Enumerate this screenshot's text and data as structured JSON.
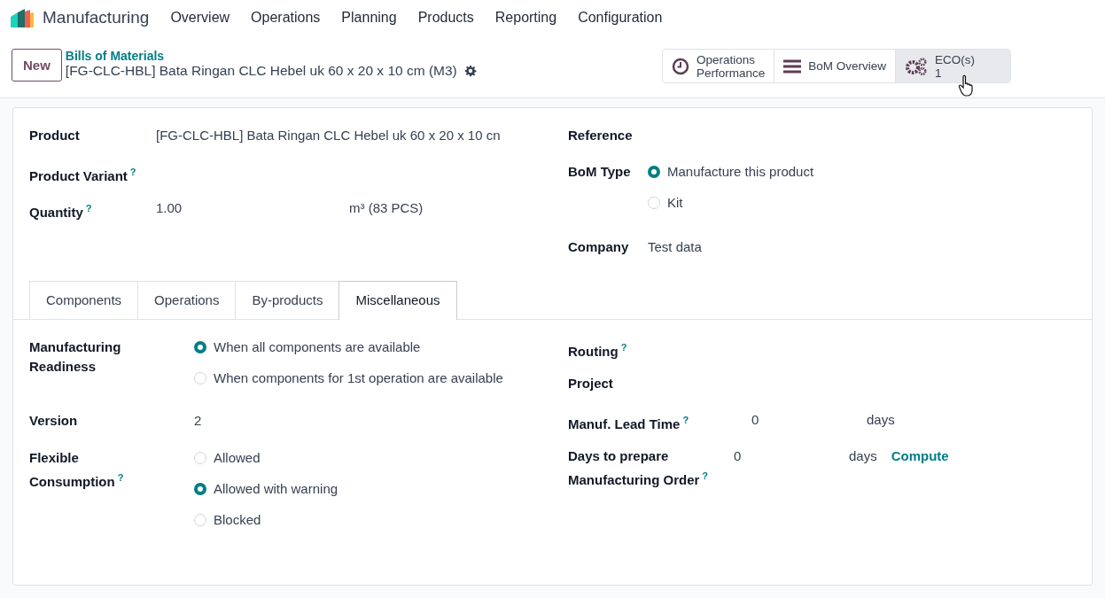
{
  "app": {
    "name": "Manufacturing",
    "menu": [
      "Overview",
      "Operations",
      "Planning",
      "Products",
      "Reporting",
      "Configuration"
    ]
  },
  "control_panel": {
    "new_button": "New",
    "breadcrumb_parent": "Bills of Materials",
    "record_title": "[FG-CLC-HBL] Bata Ringan CLC Hebel uk 60 x 20 x 10 cm (M3)"
  },
  "smart_buttons": [
    {
      "kind": "clock",
      "lines": [
        "Operations",
        "Performance"
      ],
      "hovered": false
    },
    {
      "kind": "list",
      "lines": [
        "BoM Overview"
      ],
      "hovered": false
    },
    {
      "kind": "gears",
      "lines": [
        "ECO(s)",
        "1"
      ],
      "hovered": true
    }
  ],
  "header_left": [
    {
      "kind": "text",
      "label": "Product",
      "value": "[FG-CLC-HBL] Bata Ringan CLC Hebel uk 60 x 20 x 10 cn"
    },
    {
      "kind": "text",
      "label": "Product Variant",
      "help": "?"
    },
    {
      "kind": "text",
      "label": "Quantity",
      "help": "?",
      "value": "1.00",
      "unit": "m³ (83 PCS)"
    }
  ],
  "header_right": [
    {
      "kind": "text",
      "label": "Reference"
    },
    {
      "kind": "radio",
      "label": "BoM Type",
      "options": [
        {
          "label": "Manufacture this product",
          "selected": true
        },
        {
          "label": "Kit",
          "selected": false
        }
      ]
    },
    {
      "kind": "text",
      "label": "Company",
      "value": "Test data"
    }
  ],
  "tabs": [
    {
      "label": "Components",
      "selected": false
    },
    {
      "label": "Operations",
      "selected": false
    },
    {
      "label": "By-products",
      "selected": false
    },
    {
      "label": "Miscellaneous",
      "selected": true
    }
  ],
  "misc_left": [
    {
      "kind": "radio",
      "label": "Manufacturing Readiness",
      "options": [
        {
          "label": "When all components are available",
          "selected": true
        },
        {
          "label": "When components for 1st operation are available",
          "selected": false
        }
      ]
    },
    {
      "kind": "text",
      "label": "Version",
      "value": "2"
    },
    {
      "kind": "radio",
      "label": "Flexible Consumption",
      "help": "?",
      "options": [
        {
          "label": "Allowed",
          "selected": false
        },
        {
          "label": "Allowed with warning",
          "selected": true
        },
        {
          "label": "Blocked",
          "selected": false
        }
      ]
    }
  ],
  "misc_right": [
    {
      "kind": "text",
      "label": "Routing",
      "help": "?"
    },
    {
      "kind": "text",
      "label": "Project"
    },
    {
      "kind": "text",
      "label": "Manuf. Lead Time",
      "help": "?",
      "value": "0",
      "unit": "days"
    },
    {
      "kind": "text",
      "label": "Days to prepare Manufacturing Order",
      "help": "?",
      "value": "0",
      "unit": "days",
      "action": "Compute"
    }
  ]
}
